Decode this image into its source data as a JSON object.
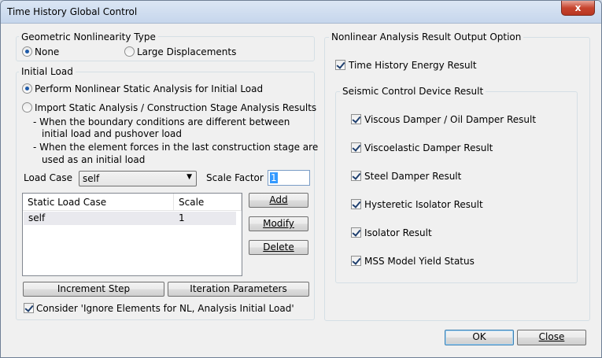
{
  "window": {
    "title": "Time History Global Control",
    "close_glyph": "x"
  },
  "geometric": {
    "title": "Geometric Nonlinearity Type",
    "options": [
      {
        "label": "None",
        "selected": true
      },
      {
        "label": "Large Displacements",
        "selected": false
      }
    ]
  },
  "initial_load": {
    "title": "Initial Load",
    "option_static": "Perform Nonlinear Static Analysis for Initial Load",
    "option_import": "Import Static Analysis / Construction Stage Analysis Results",
    "note1_line1": "- When the boundary conditions are different between",
    "note1_line2": "initial load and pushover load",
    "note2_line1": "- When the element forces in the last construction stage are",
    "note2_line2": "used as an initial load",
    "load_case_label": "Load Case",
    "load_case_value": "self",
    "scale_factor_label": "Scale Factor",
    "scale_factor_value": "1",
    "table": {
      "headers": [
        "Static Load Case",
        "Scale"
      ],
      "rows": [
        {
          "load_case": "self",
          "scale": "1"
        }
      ]
    },
    "add_button": "Add",
    "modify_button": "Modify",
    "delete_button": "Delete",
    "increment_step_button": "Increment Step",
    "iteration_parameters_button": "Iteration Parameters",
    "consider_ignore_label": "Consider 'Ignore Elements for NL, Analysis Initial Load'",
    "consider_ignore_checked": true
  },
  "output": {
    "title": "Nonlinear Analysis Result Output Option",
    "energy_label": "Time History Energy Result",
    "energy_checked": true,
    "seismic": {
      "title": "Seismic Control Device Result",
      "items": [
        {
          "label": "Viscous Damper / Oil Damper Result",
          "checked": true
        },
        {
          "label": "Viscoelastic Damper Result",
          "checked": true
        },
        {
          "label": "Steel Damper Result",
          "checked": true
        },
        {
          "label": "Hysteretic Isolator Result",
          "checked": true
        },
        {
          "label": "Isolator Result",
          "checked": true
        },
        {
          "label": "MSS Model Yield Status",
          "checked": true
        }
      ]
    }
  },
  "footer": {
    "ok": "OK",
    "close": "Close"
  }
}
